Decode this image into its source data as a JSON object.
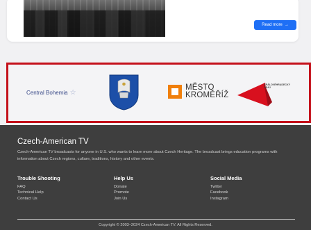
{
  "card": {
    "read_more_label": "Read more",
    "read_more_icon": "arrow-right-icon"
  },
  "partners": {
    "central_bohemia": "Central Bohemia",
    "mesto_line1": "MĚSTO",
    "mesto_line2": "KROMĚŘÍŽ",
    "kraj_line1": "KRÁLOVÉHRADECKÝ",
    "kraj_line2": "KRAJ"
  },
  "footer": {
    "title": "Czech-American TV",
    "description": "Czech-American TV broadcasts for anyone in U.S. who wants to learn more about Czech Heritage. The broadcast brings education programs with information about Czech regions, culture, traditions, history and other events.",
    "columns": [
      {
        "heading": "Trouble Shooting",
        "links": [
          "FAQ",
          "Technical Help",
          "Contact Us"
        ]
      },
      {
        "heading": "Help Us",
        "links": [
          "Donate",
          "Promote",
          "Join Us"
        ]
      },
      {
        "heading": "Social Media",
        "links": [
          "Twitter",
          "Facebook",
          "Instagram"
        ]
      }
    ],
    "copyright": "Copyright © 2003–2024 Czech-American TV. All Rights Reserved."
  },
  "colors": {
    "accent": "#1e6ff5",
    "highlight_border": "#c4101a",
    "footer_bg": "#3e3e3e",
    "mesto_orange": "#f07f0c"
  }
}
